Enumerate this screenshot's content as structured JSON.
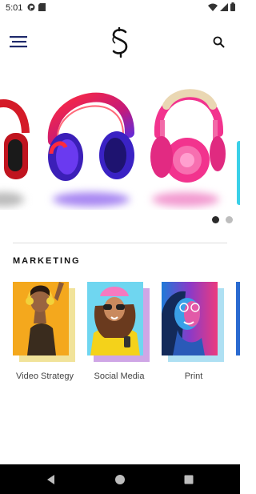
{
  "status_bar": {
    "time": "5:01",
    "icons_left": [
      "p-app-icon",
      "sd-card-icon"
    ],
    "icons_right": [
      "wifi-icon",
      "signal-icon",
      "battery-icon"
    ]
  },
  "app_bar": {
    "menu_icon": "hamburger-menu-icon",
    "logo": "s-logo",
    "search_icon": "search-icon"
  },
  "carousel": {
    "items": [
      {
        "name": "red-headphones",
        "color": "#e01c2b"
      },
      {
        "name": "purple-red-headphones",
        "color": "#7a2bd8"
      },
      {
        "name": "pink-headphones",
        "color": "#f2338e"
      }
    ],
    "active_page": 1,
    "page_count": 2
  },
  "section": {
    "title": "MARKETING"
  },
  "cards": [
    {
      "label": "Video Strategy",
      "accent": "#f1e39a"
    },
    {
      "label": "Social Media",
      "accent": "#cfa6e6"
    },
    {
      "label": "Print",
      "accent": "#aee0f3"
    }
  ],
  "colors": {
    "accent": "#1f2a6b",
    "nav_bar": "#000000"
  }
}
